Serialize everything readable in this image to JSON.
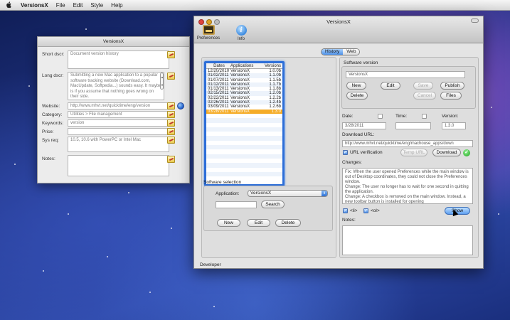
{
  "menubar": {
    "app_name": "VersionsX",
    "items": [
      "File",
      "Edit",
      "Style",
      "Help"
    ]
  },
  "info_window": {
    "title": "VersionsX",
    "short_descr_label": "Short dscr:",
    "short_descr_value": "Document version history",
    "long_descr_label": "Long dscr:",
    "long_descr_value": "Submitting a new Mac application to a popular software tracking website (Download.com, MacUpdate, Softpedia...) sounds easy.  It maybe is if you assume that nothing goes wrong on their side.",
    "website_label": "Website:",
    "website_value": "http://www.mhvt.net/quicktime/eng/version",
    "category_label": "Category:",
    "category_value": "Utilities > File management",
    "keywords_label": "Keywords:",
    "keywords_value": "version",
    "price_label": "Price:",
    "price_value": "",
    "sysreq_label": "Sys req:",
    "sysreq_value": "10.5, 10.6 with PowerPC or Intel Mac",
    "notes_label": "Notes:",
    "notes_value": ""
  },
  "main_window": {
    "title": "VersionsX",
    "toolbar": {
      "preferences_label": "Preferences",
      "info_label": "Info"
    },
    "tabs": [
      "History",
      "Web"
    ],
    "active_tab": "History",
    "versions_table": {
      "columns": [
        "Dates",
        "Applications",
        "Versions"
      ],
      "rows": [
        [
          "12/20/2010",
          "VersionsX",
          "1.0.0b"
        ],
        [
          "01/02/2011",
          "VersionsX",
          "1.1.0b"
        ],
        [
          "01/07/2011",
          "VersionsX",
          "1.1.5b"
        ],
        [
          "01/12/2011",
          "VersionsX",
          "1.1.7b"
        ],
        [
          "01/13/2011",
          "VersionsX",
          "1.1.8b"
        ],
        [
          "02/15/2011",
          "VersionsX",
          "1.2.0b"
        ],
        [
          "02/22/2011",
          "VersionsX",
          "1.2.2b"
        ],
        [
          "02/26/2011",
          "VersionsX",
          "1.2.4b"
        ],
        [
          "03/09/2011",
          "VersionsX",
          "1.2.6b"
        ],
        [
          "03/28/2011",
          "VersionsX",
          "1.3.0"
        ]
      ],
      "selected_row": 9
    },
    "software_selection": {
      "title": "Software selection",
      "application_label": "Application:",
      "application_value": "VersionsX",
      "search_value": "",
      "search_button": "Search",
      "new_button": "New",
      "edit_button": "Edit",
      "delete_button": "Delete"
    },
    "software_version": {
      "title": "Software version",
      "name_value": "VersionsX",
      "new_button": "New",
      "edit_button": "Edit",
      "save_button": "Save",
      "publish_button": "Publish",
      "delete_button": "Delete",
      "cancel_button": "Cancel",
      "files_button": "Files",
      "date_label": "Date:",
      "date_value": "3/28/2011",
      "time_label": "Time:",
      "time_value": "",
      "version_label": "Version:",
      "version_value": "1.3.0",
      "download_url_label": "Download URL:",
      "download_url_value": "http://www.mhvt.net/quicktime/eng/machouse_apps/down",
      "url_verification_label": "URL verification",
      "temp_url_button": "Temp URL",
      "download_button": "Download",
      "changes_label": "Changes:",
      "changes_value": "Fix: When the user opened Preferences while the main window is out of Desktop coordinates, they could not close the Preferences window.\nChange: The user no longer has to wait for one second in quitting the application.\nChange: A checkbox is removed on the main window. Instead, a new toolbar button is installed for opening",
      "li_label": "<li>",
      "ol_label": "<ol>",
      "show_button": "Show",
      "notes_label": "Notes:",
      "notes_value": ""
    },
    "statusbar": "Developer"
  }
}
